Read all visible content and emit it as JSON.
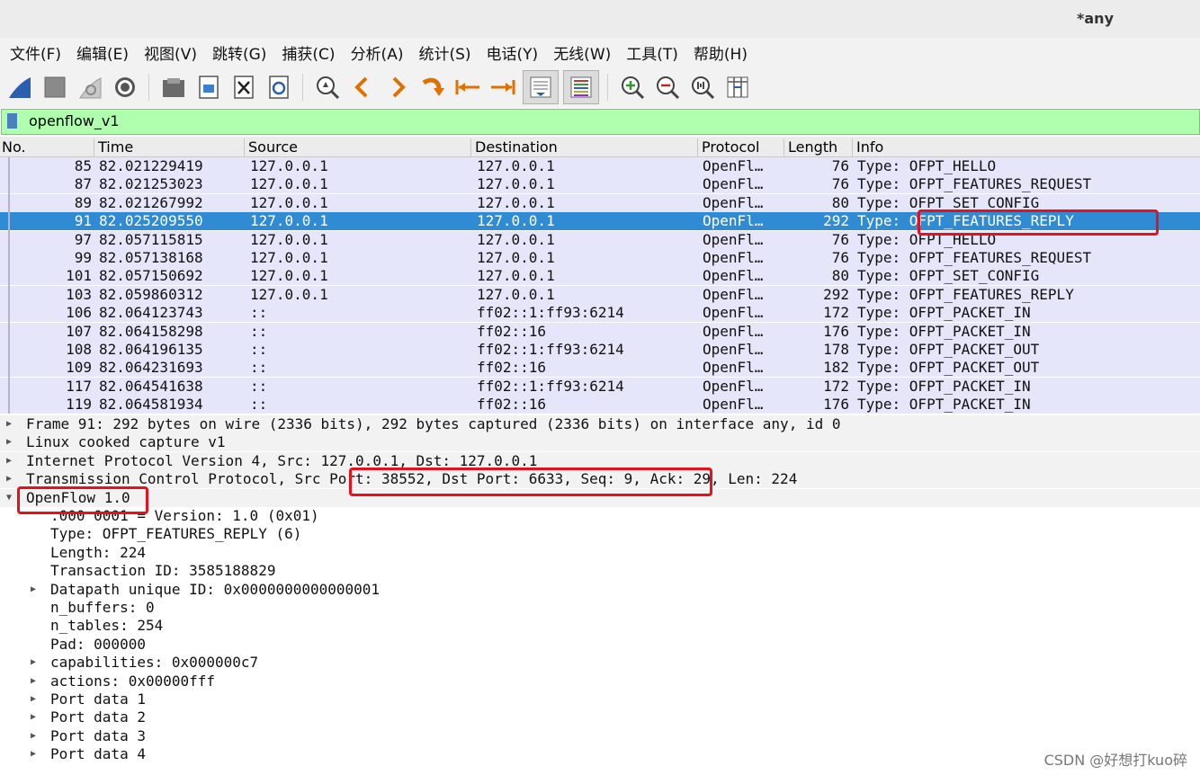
{
  "window": {
    "title": "*any"
  },
  "menu": [
    "文件(F)",
    "编辑(E)",
    "视图(V)",
    "跳转(G)",
    "捕获(C)",
    "分析(A)",
    "统计(S)",
    "电话(Y)",
    "无线(W)",
    "工具(T)",
    "帮助(H)"
  ],
  "toolbar": {
    "icons": [
      "shark-fin-start-icon",
      "stop-square-icon",
      "restart-fin-icon",
      "options-gear-icon",
      "open-folder-icon",
      "save-file-icon",
      "close-file-icon",
      "reload-file-icon",
      "find-packet-icon",
      "go-back-icon",
      "go-forward-icon",
      "go-to-packet-icon",
      "first-packet-icon",
      "last-packet-icon",
      "autoscroll-icon",
      "colorize-icon",
      "zoom-in-icon",
      "zoom-out-icon",
      "normal-size-icon",
      "resize-columns-icon"
    ]
  },
  "filter": {
    "value": "openflow_v1"
  },
  "packet_list": {
    "columns": [
      "No.",
      "Time",
      "Source",
      "Destination",
      "Protocol",
      "Length",
      "Info"
    ],
    "rows": [
      {
        "no": "85",
        "time": "82.021229419",
        "src": "127.0.0.1",
        "dst": "127.0.0.1",
        "proto": "OpenFl…",
        "len": "76",
        "info": "Type: OFPT_HELLO"
      },
      {
        "no": "87",
        "time": "82.021253023",
        "src": "127.0.0.1",
        "dst": "127.0.0.1",
        "proto": "OpenFl…",
        "len": "76",
        "info": "Type: OFPT_FEATURES_REQUEST"
      },
      {
        "no": "89",
        "time": "82.021267992",
        "src": "127.0.0.1",
        "dst": "127.0.0.1",
        "proto": "OpenFl…",
        "len": "80",
        "info": "Type: OFPT_SET_CONFIG"
      },
      {
        "no": "91",
        "time": "82.025209550",
        "src": "127.0.0.1",
        "dst": "127.0.0.1",
        "proto": "OpenFl…",
        "len": "292",
        "info": "Type: OFPT_FEATURES_REPLY"
      },
      {
        "no": "97",
        "time": "82.057115815",
        "src": "127.0.0.1",
        "dst": "127.0.0.1",
        "proto": "OpenFl…",
        "len": "76",
        "info": "Type: OFPT_HELLO"
      },
      {
        "no": "99",
        "time": "82.057138168",
        "src": "127.0.0.1",
        "dst": "127.0.0.1",
        "proto": "OpenFl…",
        "len": "76",
        "info": "Type: OFPT_FEATURES_REQUEST"
      },
      {
        "no": "101",
        "time": "82.057150692",
        "src": "127.0.0.1",
        "dst": "127.0.0.1",
        "proto": "OpenFl…",
        "len": "80",
        "info": "Type: OFPT_SET_CONFIG"
      },
      {
        "no": "103",
        "time": "82.059860312",
        "src": "127.0.0.1",
        "dst": "127.0.0.1",
        "proto": "OpenFl…",
        "len": "292",
        "info": "Type: OFPT_FEATURES_REPLY"
      },
      {
        "no": "106",
        "time": "82.064123743",
        "src": "::",
        "dst": "ff02::1:ff93:6214",
        "proto": "OpenFl…",
        "len": "172",
        "info": "Type: OFPT_PACKET_IN"
      },
      {
        "no": "107",
        "time": "82.064158298",
        "src": "::",
        "dst": "ff02::16",
        "proto": "OpenFl…",
        "len": "176",
        "info": "Type: OFPT_PACKET_IN"
      },
      {
        "no": "108",
        "time": "82.064196135",
        "src": "::",
        "dst": "ff02::1:ff93:6214",
        "proto": "OpenFl…",
        "len": "178",
        "info": "Type: OFPT_PACKET_OUT"
      },
      {
        "no": "109",
        "time": "82.064231693",
        "src": "::",
        "dst": "ff02::16",
        "proto": "OpenFl…",
        "len": "182",
        "info": "Type: OFPT_PACKET_OUT"
      },
      {
        "no": "117",
        "time": "82.064541638",
        "src": "::",
        "dst": "ff02::1:ff93:6214",
        "proto": "OpenFl…",
        "len": "172",
        "info": "Type: OFPT_PACKET_IN"
      },
      {
        "no": "119",
        "time": "82.064581934",
        "src": "::",
        "dst": "ff02::16",
        "proto": "OpenFl…",
        "len": "176",
        "info": "Type: OFPT_PACKET_IN"
      }
    ]
  },
  "details": {
    "items": [
      {
        "text": "Frame 91: 292 bytes on wire (2336 bits), 292 bytes captured (2336 bits) on interface any, id 0",
        "level": 0,
        "arrow": "right"
      },
      {
        "text": "Linux cooked capture v1",
        "level": 0,
        "arrow": "right"
      },
      {
        "text": "Internet Protocol Version 4, Src: 127.0.0.1, Dst: 127.0.0.1",
        "level": 0,
        "arrow": "right"
      },
      {
        "text": "Transmission Control Protocol, Src Port: 38552, Dst Port: 6633, Seq: 9, Ack: 29, Len: 224",
        "level": 0,
        "arrow": "right"
      },
      {
        "text": "OpenFlow 1.0",
        "level": 0,
        "arrow": "down"
      },
      {
        "text": ".000 0001 = Version: 1.0 (0x01)",
        "level": 1,
        "arrow": ""
      },
      {
        "text": "Type: OFPT_FEATURES_REPLY (6)",
        "level": 1,
        "arrow": ""
      },
      {
        "text": "Length: 224",
        "level": 1,
        "arrow": ""
      },
      {
        "text": "Transaction ID: 3585188829",
        "level": 1,
        "arrow": ""
      },
      {
        "text": "Datapath unique ID: 0x0000000000000001",
        "level": 1,
        "arrow": "right"
      },
      {
        "text": "n_buffers: 0",
        "level": 1,
        "arrow": ""
      },
      {
        "text": "n_tables: 254",
        "level": 1,
        "arrow": ""
      },
      {
        "text": "Pad: 000000",
        "level": 1,
        "arrow": ""
      },
      {
        "text": "capabilities: 0x000000c7",
        "level": 1,
        "arrow": "right"
      },
      {
        "text": "actions: 0x00000fff",
        "level": 1,
        "arrow": "right"
      },
      {
        "text": "Port data 1",
        "level": 1,
        "arrow": "right"
      },
      {
        "text": "Port data 2",
        "level": 1,
        "arrow": "right"
      },
      {
        "text": "Port data 3",
        "level": 1,
        "arrow": "right"
      },
      {
        "text": "Port data 4",
        "level": 1,
        "arrow": "right"
      }
    ]
  },
  "watermark": "CSDN @好想打kuo碎",
  "colors": {
    "selected_row": "#2f8bd3",
    "row_bg": "#e6e6fa",
    "filter_bg": "#afffaf",
    "highlight_box": "#e8101a"
  }
}
